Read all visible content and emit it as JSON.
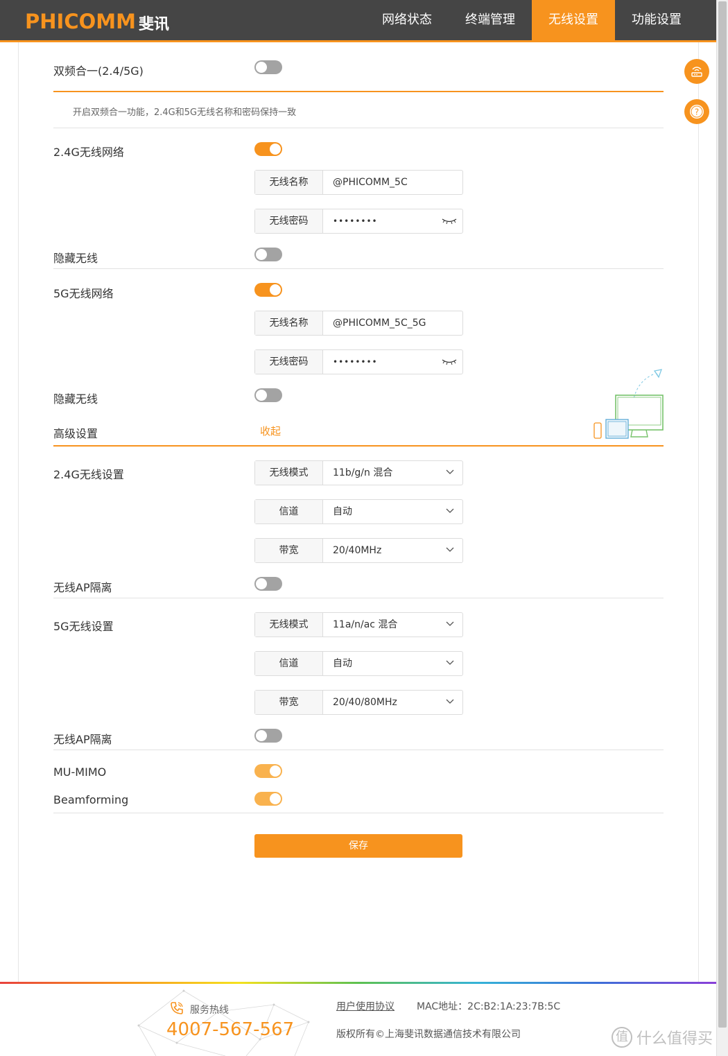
{
  "header": {
    "logo_en": "PHICOMM",
    "logo_cn": "斐讯",
    "nav": [
      {
        "label": "网络状态",
        "active": false
      },
      {
        "label": "终端管理",
        "active": false
      },
      {
        "label": "无线设置",
        "active": true
      },
      {
        "label": "功能设置",
        "active": false
      }
    ]
  },
  "dual_band": {
    "label": "双频合一(2.4/5G)",
    "enabled": false,
    "hint": "开启双频合一功能，2.4G和5G无线名称和密码保持一致"
  },
  "wifi_24g": {
    "label": "2.4G无线网络",
    "enabled": true,
    "ssid_label": "无线名称",
    "ssid": "@PHICOMM_5C",
    "pwd_label": "无线密码",
    "pwd": "••••••••",
    "hide_label": "隐藏无线",
    "hide": false
  },
  "wifi_5g": {
    "label": "5G无线网络",
    "enabled": true,
    "ssid_label": "无线名称",
    "ssid": "@PHICOMM_5C_5G",
    "pwd_label": "无线密码",
    "pwd": "••••••••",
    "hide_label": "隐藏无线",
    "hide": false
  },
  "advanced": {
    "label": "高级设置",
    "collapse": "收起"
  },
  "adv_24g": {
    "label": "2.4G无线设置",
    "mode_label": "无线模式",
    "mode": "11b/g/n 混合",
    "channel_label": "信道",
    "channel": "自动",
    "bw_label": "带宽",
    "bw": "20/40MHz",
    "ap_iso_label": "无线AP隔离",
    "ap_iso": false
  },
  "adv_5g": {
    "label": "5G无线设置",
    "mode_label": "无线模式",
    "mode": "11a/n/ac 混合",
    "channel_label": "信道",
    "channel": "自动",
    "bw_label": "带宽",
    "bw": "20/40/80MHz",
    "ap_iso_label": "无线AP隔离",
    "ap_iso": false
  },
  "mu_mimo": {
    "label": "MU-MIMO",
    "enabled": true
  },
  "beamforming": {
    "label": "Beamforming",
    "enabled": true
  },
  "save_label": "保存",
  "footer": {
    "hotline_label": "服务热线",
    "hotline": "4007-567-567",
    "agreement": "用户使用协议",
    "mac": "MAC地址：2C:B2:1A:23:7B:5C",
    "copyright": "版权所有©上海斐讯数据通信技术有限公司",
    "watermark": "什么值得买",
    "watermark_badge": "值"
  },
  "colors": {
    "accent": "#f7931e",
    "header_bg": "#454545"
  }
}
